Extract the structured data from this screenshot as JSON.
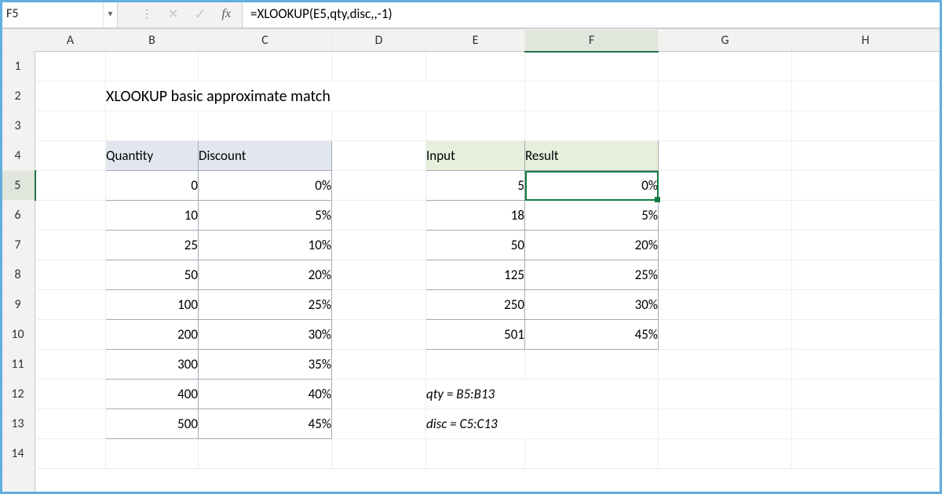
{
  "nameBox": "F5",
  "formula": "=XLOOKUP(E5,qty,disc,,-1)",
  "colHeaders": [
    "A",
    "B",
    "C",
    "D",
    "E",
    "F",
    "G",
    "H"
  ],
  "rowHeaders": [
    "1",
    "2",
    "3",
    "4",
    "5",
    "6",
    "7",
    "8",
    "9",
    "10",
    "11",
    "12",
    "13",
    "14"
  ],
  "title": "XLOOKUP basic approximate match",
  "table1": {
    "headers": [
      "Quantity",
      "Discount"
    ],
    "rows": [
      [
        "0",
        "0%"
      ],
      [
        "10",
        "5%"
      ],
      [
        "25",
        "10%"
      ],
      [
        "50",
        "20%"
      ],
      [
        "100",
        "25%"
      ],
      [
        "200",
        "30%"
      ],
      [
        "300",
        "35%"
      ],
      [
        "400",
        "40%"
      ],
      [
        "500",
        "45%"
      ]
    ]
  },
  "table2": {
    "headers": [
      "Input",
      "Result"
    ],
    "rows": [
      [
        "5",
        "0%"
      ],
      [
        "18",
        "5%"
      ],
      [
        "50",
        "20%"
      ],
      [
        "125",
        "25%"
      ],
      [
        "250",
        "30%"
      ],
      [
        "501",
        "45%"
      ]
    ]
  },
  "notes": {
    "qty": "qty = B5:B13",
    "disc": "disc = C5:C13"
  },
  "selectedCell": "F5",
  "selectedCol": "F",
  "selectedRow": "5"
}
